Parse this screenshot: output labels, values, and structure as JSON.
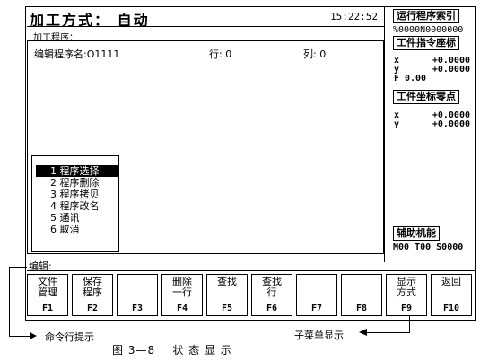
{
  "header": {
    "title": "加工方式： 自动",
    "time": "15:22:52",
    "program_label": "加工程序："
  },
  "editor": {
    "program_name": "编辑程序名:O1111",
    "row": "行: 0",
    "col": "列: 0"
  },
  "popup_menu": {
    "items": [
      {
        "label": "1 程序选择",
        "selected": true
      },
      {
        "label": "2 程序删除",
        "selected": false
      },
      {
        "label": "3 程序拷贝",
        "selected": false
      },
      {
        "label": "4 程序改名",
        "selected": false
      },
      {
        "label": "5 通讯",
        "selected": false
      },
      {
        "label": "6 取消",
        "selected": false
      }
    ]
  },
  "right_panel": {
    "run_index_title": "运行程序索引",
    "run_index_value": "%0000N0000000",
    "work_cmd_title": "工件指令座标",
    "work_cmd": {
      "x": {
        "label": "x",
        "value": "+0.0000"
      },
      "y": {
        "label": "y",
        "value": "+0.0000"
      },
      "f": {
        "label": "F",
        "value": "0.00"
      }
    },
    "work_zero_title": "工件坐标零点",
    "work_zero": {
      "x": {
        "label": "x",
        "value": "+0.0000"
      },
      "y": {
        "label": "y",
        "value": "+0.0000"
      }
    },
    "aux_title": "辅助机能",
    "aux_value": "M00 T00 S0000"
  },
  "command_line": {
    "label": "编辑:"
  },
  "function_keys": [
    {
      "label": "文件\n管理",
      "key": "F1"
    },
    {
      "label": "保存\n程序",
      "key": "F2"
    },
    {
      "label": "",
      "key": "F3"
    },
    {
      "label": "删除\n一行",
      "key": "F4"
    },
    {
      "label": "查找",
      "key": "F5"
    },
    {
      "label": "查找\n行",
      "key": "F6"
    },
    {
      "label": "",
      "key": "F7"
    },
    {
      "label": "",
      "key": "F8"
    },
    {
      "label": "显示\n方式",
      "key": "F9"
    },
    {
      "label": "返回",
      "key": "F10"
    }
  ],
  "annotations": {
    "command_hint": "命令行提示",
    "submenu_hint": "子菜单显示",
    "caption": "图 3—8    状 态 显 示"
  }
}
